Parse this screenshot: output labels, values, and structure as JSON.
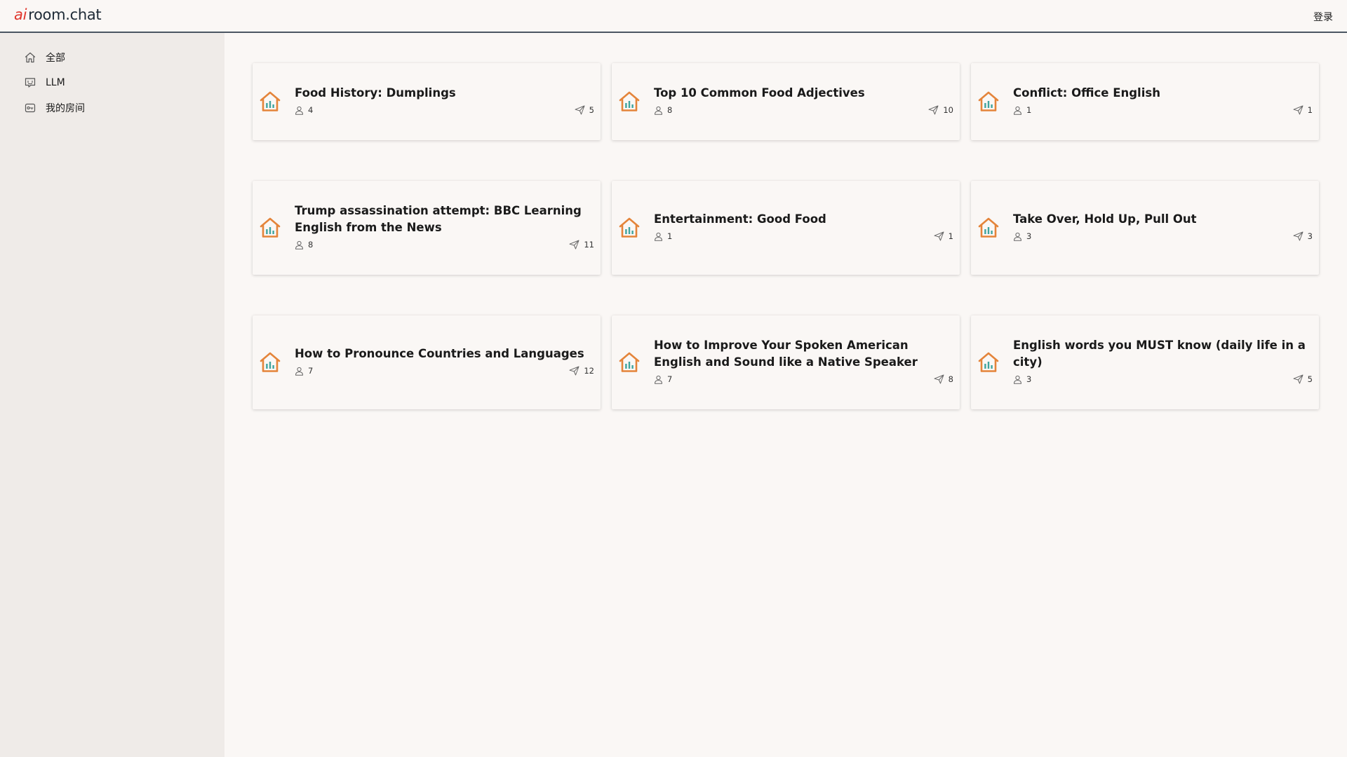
{
  "header": {
    "logo_ai": "ai",
    "logo_rest": "room.chat",
    "login_label": "登录"
  },
  "sidebar": {
    "items": [
      {
        "label": "全部",
        "icon": "home-icon"
      },
      {
        "label": "LLM",
        "icon": "chat-icon"
      },
      {
        "label": "我的房间",
        "icon": "key-icon"
      }
    ]
  },
  "colors": {
    "room_icon_orange": "#e4843a",
    "room_icon_teal": "#3ea49e",
    "logo_ai_red": "#e0352b",
    "sidebar_bg": "#efebe8",
    "page_bg": "#faf7f5"
  },
  "rooms": [
    {
      "title": "Food History: Dumplings",
      "members": "4",
      "messages": "5"
    },
    {
      "title": "Top 10 Common Food Adjectives",
      "members": "8",
      "messages": "10"
    },
    {
      "title": "Conflict: Office English",
      "members": "1",
      "messages": "1"
    },
    {
      "title": "Trump assassination attempt: BBC Learning English from the News",
      "members": "8",
      "messages": "11"
    },
    {
      "title": "Entertainment: Good Food",
      "members": "1",
      "messages": "1"
    },
    {
      "title": "Take Over, Hold Up, Pull Out",
      "members": "3",
      "messages": "3"
    },
    {
      "title": "How to Pronounce Countries and Languages",
      "members": "7",
      "messages": "12"
    },
    {
      "title": "How to Improve Your Spoken American English and Sound like a Native Speaker",
      "members": "7",
      "messages": "8"
    },
    {
      "title": "English words you MUST know (daily life in a city)",
      "members": "3",
      "messages": "5"
    }
  ]
}
